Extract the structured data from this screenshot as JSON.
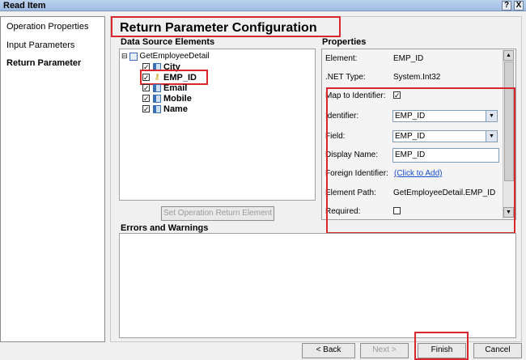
{
  "window": {
    "title": "Read Item",
    "help_glyph": "?",
    "close_glyph": "X"
  },
  "nav": {
    "items": [
      {
        "label": "Operation Properties",
        "active": false
      },
      {
        "label": "Input Parameters",
        "active": false
      },
      {
        "label": "Return Parameter",
        "active": true
      }
    ]
  },
  "main": {
    "header": "Return Parameter Configuration",
    "data_source_label": "Data Source Elements",
    "properties_label": "Properties",
    "errors_label": "Errors and Warnings",
    "set_button": "Set Operation Return Element"
  },
  "tree": {
    "root": "GetEmployeeDetail",
    "expander": "⊟",
    "items": [
      {
        "label": "City",
        "checked": true,
        "icon": "column-icon"
      },
      {
        "label": "EMP_ID",
        "checked": true,
        "icon": "key-icon"
      },
      {
        "label": "Email",
        "checked": true,
        "icon": "column-icon"
      },
      {
        "label": "Mobile",
        "checked": true,
        "icon": "column-icon"
      },
      {
        "label": "Name",
        "checked": true,
        "icon": "column-icon"
      }
    ]
  },
  "properties": {
    "element_label": "Element:",
    "element_value": "EMP_ID",
    "nettype_label": ".NET Type:",
    "nettype_value": "System.Int32",
    "map_label": "Map to Identifier:",
    "map_checked": true,
    "identifier_label": "Identifier:",
    "identifier_value": "EMP_ID",
    "field_label": "Field:",
    "field_value": "EMP_ID",
    "display_label": "Display Name:",
    "display_value": "EMP_ID",
    "foreign_label": "Foreign Identifier:",
    "foreign_link": "(Click to Add)",
    "path_label": "Element Path:",
    "path_value": "GetEmployeeDetail.EMP_ID",
    "required_label": "Required:",
    "required_checked": false
  },
  "footer": {
    "back": "< Back",
    "next": "Next >",
    "finish": "Finish",
    "cancel": "Cancel"
  },
  "colors": {
    "highlight_red": "#d9262c",
    "link_blue": "#1a4fd0"
  }
}
